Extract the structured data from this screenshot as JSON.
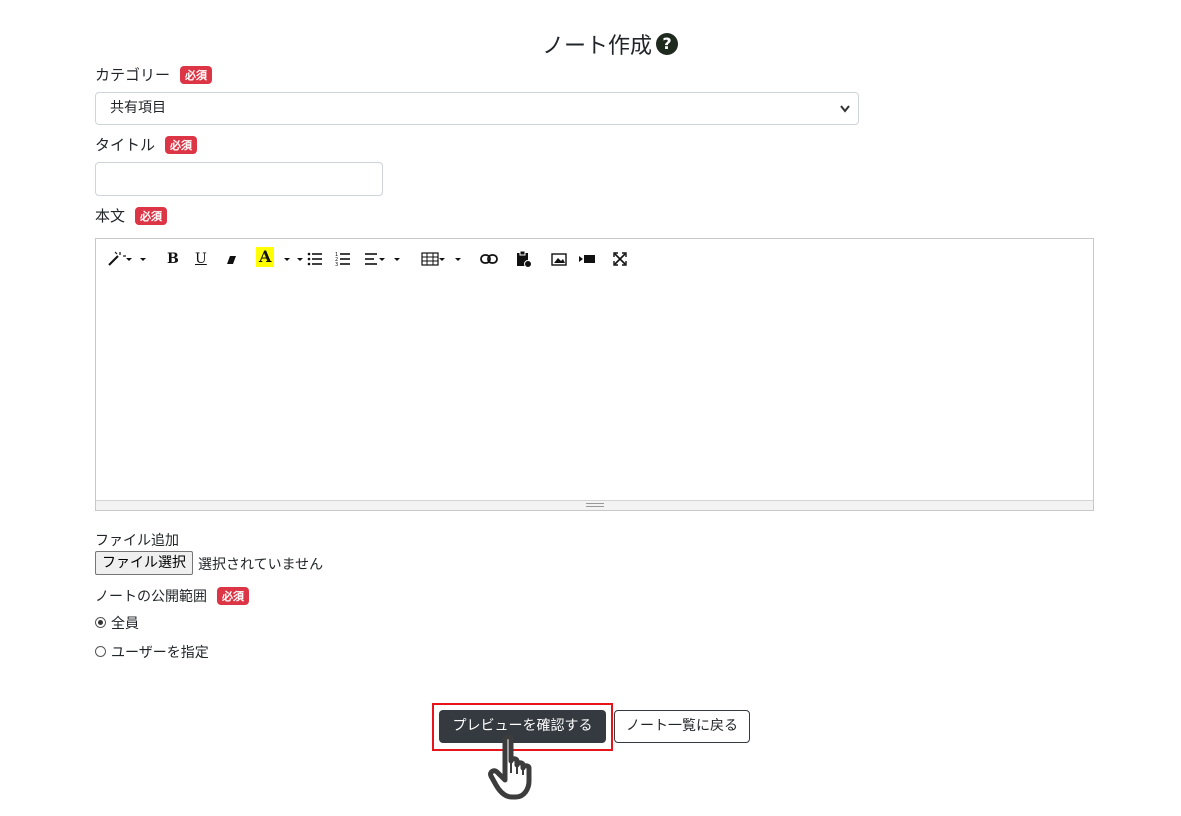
{
  "page": {
    "title": "ノート作成",
    "help_icon": "?"
  },
  "form": {
    "required_badge": "必須",
    "category": {
      "label": "カテゴリー",
      "selected": "共有項目"
    },
    "title_field": {
      "label": "タイトル",
      "value": ""
    },
    "body": {
      "label": "本文"
    },
    "file": {
      "label": "ファイル追加",
      "button": "ファイル選択",
      "status": "選択されていません"
    },
    "visibility": {
      "label": "ノートの公開範囲",
      "options": [
        {
          "label": "全員",
          "selected": true
        },
        {
          "label": "ユーザーを指定",
          "selected": false
        }
      ]
    }
  },
  "toolbar": {
    "bold": "B",
    "underline": "U",
    "color": "A",
    "icons": [
      "magic-wand-icon",
      "bold-icon",
      "underline-icon",
      "eraser-icon",
      "font-color-icon",
      "unordered-list-icon",
      "ordered-list-icon",
      "align-icon",
      "table-icon",
      "link-icon",
      "paste-icon",
      "image-icon",
      "video-icon",
      "fullscreen-icon"
    ]
  },
  "actions": {
    "preview": "プレビューを確認する",
    "back": "ノート一覧に戻る"
  },
  "colors": {
    "required": "#dc3545",
    "dark_button": "#343a40",
    "highlight": "#e8141b"
  }
}
